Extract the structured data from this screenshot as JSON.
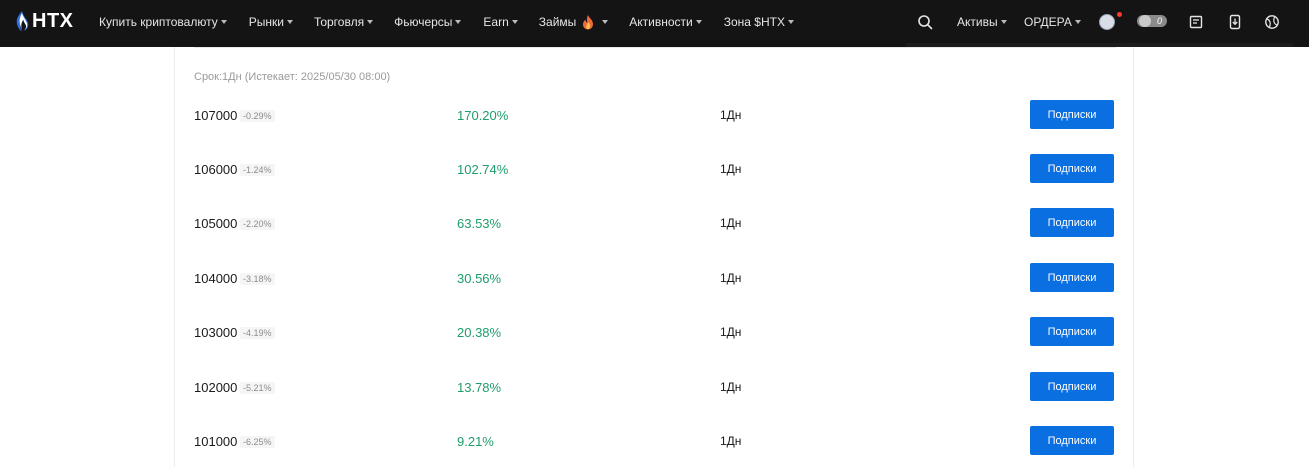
{
  "header": {
    "logo_text": "HTX",
    "nav": [
      {
        "label": "Купить криптовалюту",
        "name": "nav-buy-crypto"
      },
      {
        "label": "Рынки",
        "name": "nav-markets"
      },
      {
        "label": "Торговля",
        "name": "nav-trade"
      },
      {
        "label": "Фьючерсы",
        "name": "nav-futures"
      },
      {
        "label": "Earn",
        "name": "nav-earn"
      },
      {
        "label": "Займы",
        "name": "nav-loans",
        "icon": "flame-icon"
      },
      {
        "label": "Активности",
        "name": "nav-activities"
      },
      {
        "label": "Зона $HTX",
        "name": "nav-htx-zone"
      }
    ],
    "right": {
      "assets_label": "Активы",
      "orders_label": "ОРДЕРА",
      "points_value": "0"
    },
    "icons": [
      "search-icon",
      "avatar",
      "points-icon",
      "orders-doc-icon",
      "download-icon",
      "language-globe-icon"
    ]
  },
  "main": {
    "term_text": "Срок:1Дн (Истекает: 2025/05/30 08:00)",
    "rows": [
      {
        "strike": "107000",
        "change": "-0.29%",
        "apy": "170.20%",
        "duration": "1Дн",
        "button": "Подписки"
      },
      {
        "strike": "106000",
        "change": "-1.24%",
        "apy": "102.74%",
        "duration": "1Дн",
        "button": "Подписки"
      },
      {
        "strike": "105000",
        "change": "-2.20%",
        "apy": "63.53%",
        "duration": "1Дн",
        "button": "Подписки"
      },
      {
        "strike": "104000",
        "change": "-3.18%",
        "apy": "30.56%",
        "duration": "1Дн",
        "button": "Подписки"
      },
      {
        "strike": "103000",
        "change": "-4.19%",
        "apy": "20.38%",
        "duration": "1Дн",
        "button": "Подписки"
      },
      {
        "strike": "102000",
        "change": "-5.21%",
        "apy": "13.78%",
        "duration": "1Дн",
        "button": "Подписки"
      },
      {
        "strike": "101000",
        "change": "-6.25%",
        "apy": "9.21%",
        "duration": "1Дн",
        "button": "Подписки"
      }
    ]
  },
  "colors": {
    "topbar": "#141414",
    "accent_blue": "#0a6fe0",
    "apy_green": "#1f9d6a"
  }
}
